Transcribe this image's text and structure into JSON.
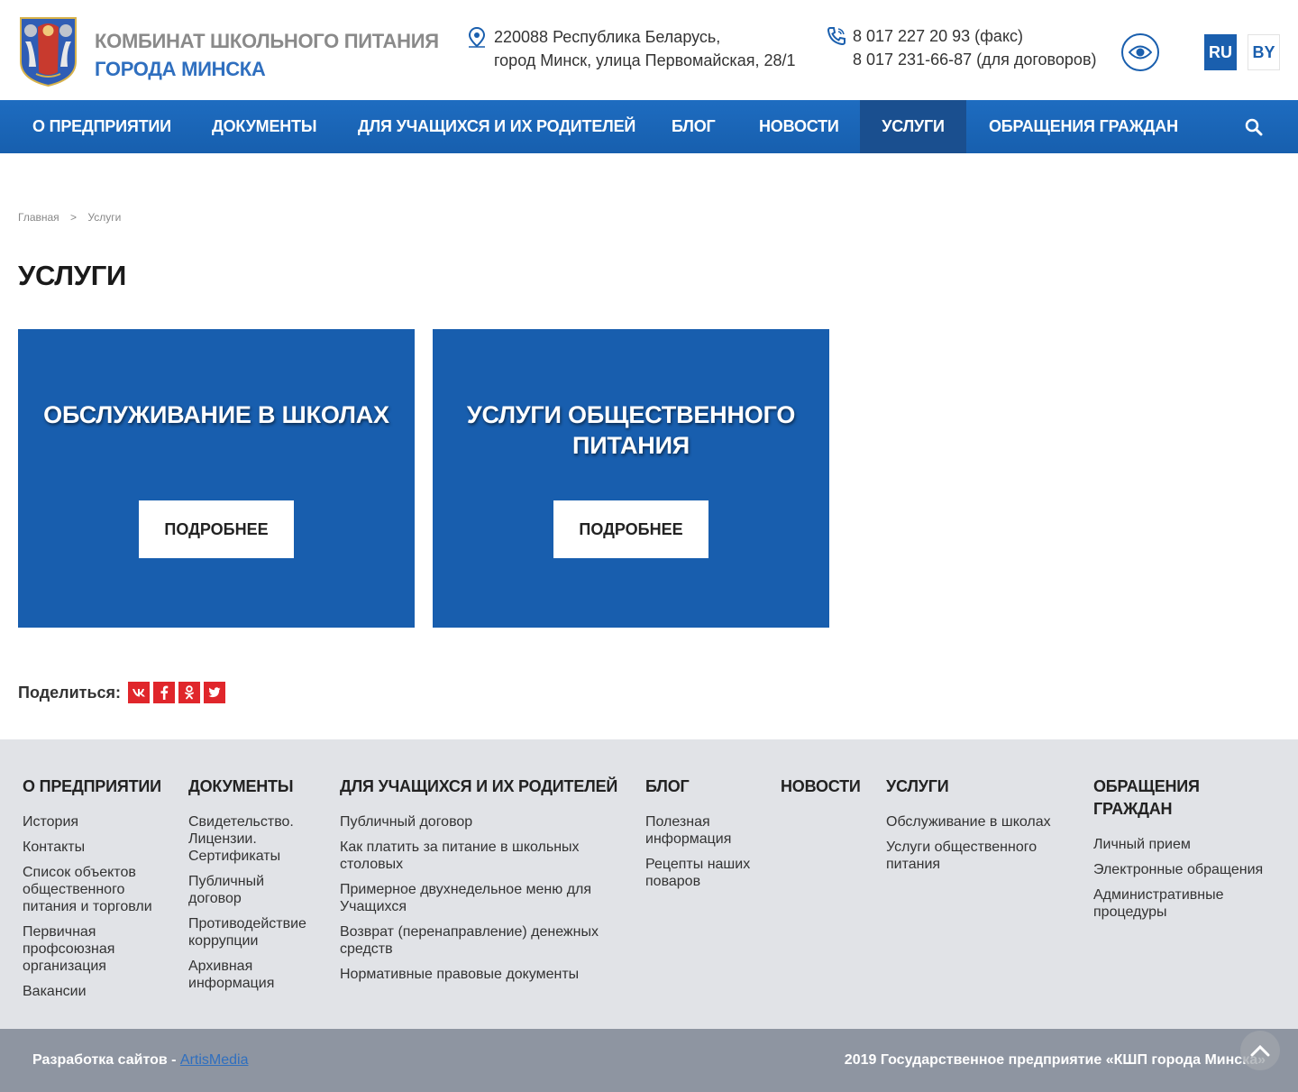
{
  "header": {
    "brand_line1": "КОМБИНАТ ШКОЛЬНОГО ПИТАНИЯ",
    "brand_line2": "ГОРОДА МИНСКА",
    "address_line1": "220088 Республика Беларусь,",
    "address_line2": "город Минск, улица Первомайская, 28/1",
    "phone1": "8 017 227 20 93 (факс)",
    "phone2": "8 017 231-66-87 (для договоров)",
    "lang_ru": "RU",
    "lang_by": "BY"
  },
  "nav": {
    "items": [
      {
        "label": "О ПРЕДПРИЯТИИ"
      },
      {
        "label": "ДОКУМЕНТЫ"
      },
      {
        "label": "ДЛЯ УЧАЩИХСЯ И ИХ РОДИТЕЛЕЙ"
      },
      {
        "label": "БЛОГ"
      },
      {
        "label": "НОВОСТИ"
      },
      {
        "label": "УСЛУГИ"
      },
      {
        "label": "ОБРАЩЕНИЯ ГРАЖДАН"
      }
    ]
  },
  "breadcrumb": {
    "home": "Главная",
    "separator": ">",
    "current": "Услуги"
  },
  "page": {
    "title": "УСЛУГИ"
  },
  "cards": [
    {
      "title": "ОБСЛУЖИВАНИЕ В ШКОЛАХ",
      "button": "ПОДРОБНЕЕ"
    },
    {
      "title": "УСЛУГИ ОБЩЕСТВЕННОГО ПИТАНИЯ",
      "button": "ПОДРОБНЕЕ"
    }
  ],
  "share": {
    "label": "Поделиться:",
    "buttons": [
      "vk",
      "f",
      "ok",
      "tw"
    ]
  },
  "footer": {
    "columns": [
      {
        "heading": "О ПРЕДПРИЯТИИ",
        "links": [
          "История",
          "Контакты",
          "Список объектов общественного питания и торговли",
          "Первичная профсоюзная организация",
          "Вакансии"
        ]
      },
      {
        "heading": "ДОКУМЕНТЫ",
        "links": [
          "Свидетельство. Лицензии. Сертификаты",
          "Публичный договор",
          "Противодействие коррупции",
          "Архивная информация"
        ]
      },
      {
        "heading": "ДЛЯ УЧАЩИХСЯ И ИХ РОДИТЕЛЕЙ",
        "links": [
          "Публичный договор",
          "Как платить за питание в школьных столовых",
          "Примерное двухнедельное меню для Учащихся",
          "Возврат (перенаправление) денежных средств",
          "Нормативные правовые документы"
        ]
      },
      {
        "heading": "БЛОГ",
        "links": [
          "Полезная информация",
          "Рецепты наших поваров"
        ]
      },
      {
        "heading": "НОВОСТИ",
        "links": []
      },
      {
        "heading": "УСЛУГИ",
        "links": [
          "Обслуживание в школах",
          "Услуги общественного питания"
        ]
      },
      {
        "heading": "ОБРАЩЕНИЯ ГРАЖДАН",
        "links": [
          "Личный прием",
          "Электронные обращения",
          "Административные процедуры"
        ]
      }
    ],
    "dev_text": "Разработка сайтов - ",
    "dev_link": "ArtisMedia",
    "copyright": "2019 Государственное предприятие «КШП города Минска»"
  },
  "colors": {
    "accent": "#1a5fae",
    "nav_active": "#1a4f8f",
    "card_bg": "#185eae",
    "share_red": "#e0262b",
    "footer_bg": "#e1e3e7",
    "bottom_bg": "#8e95a1"
  },
  "icons": {
    "logo": "coat-of-arms-icon",
    "address": "location-pin-icon",
    "phone": "phone-icon",
    "accessibility": "eye-icon",
    "search": "search-icon",
    "scroll_top": "chevron-up-icon"
  }
}
